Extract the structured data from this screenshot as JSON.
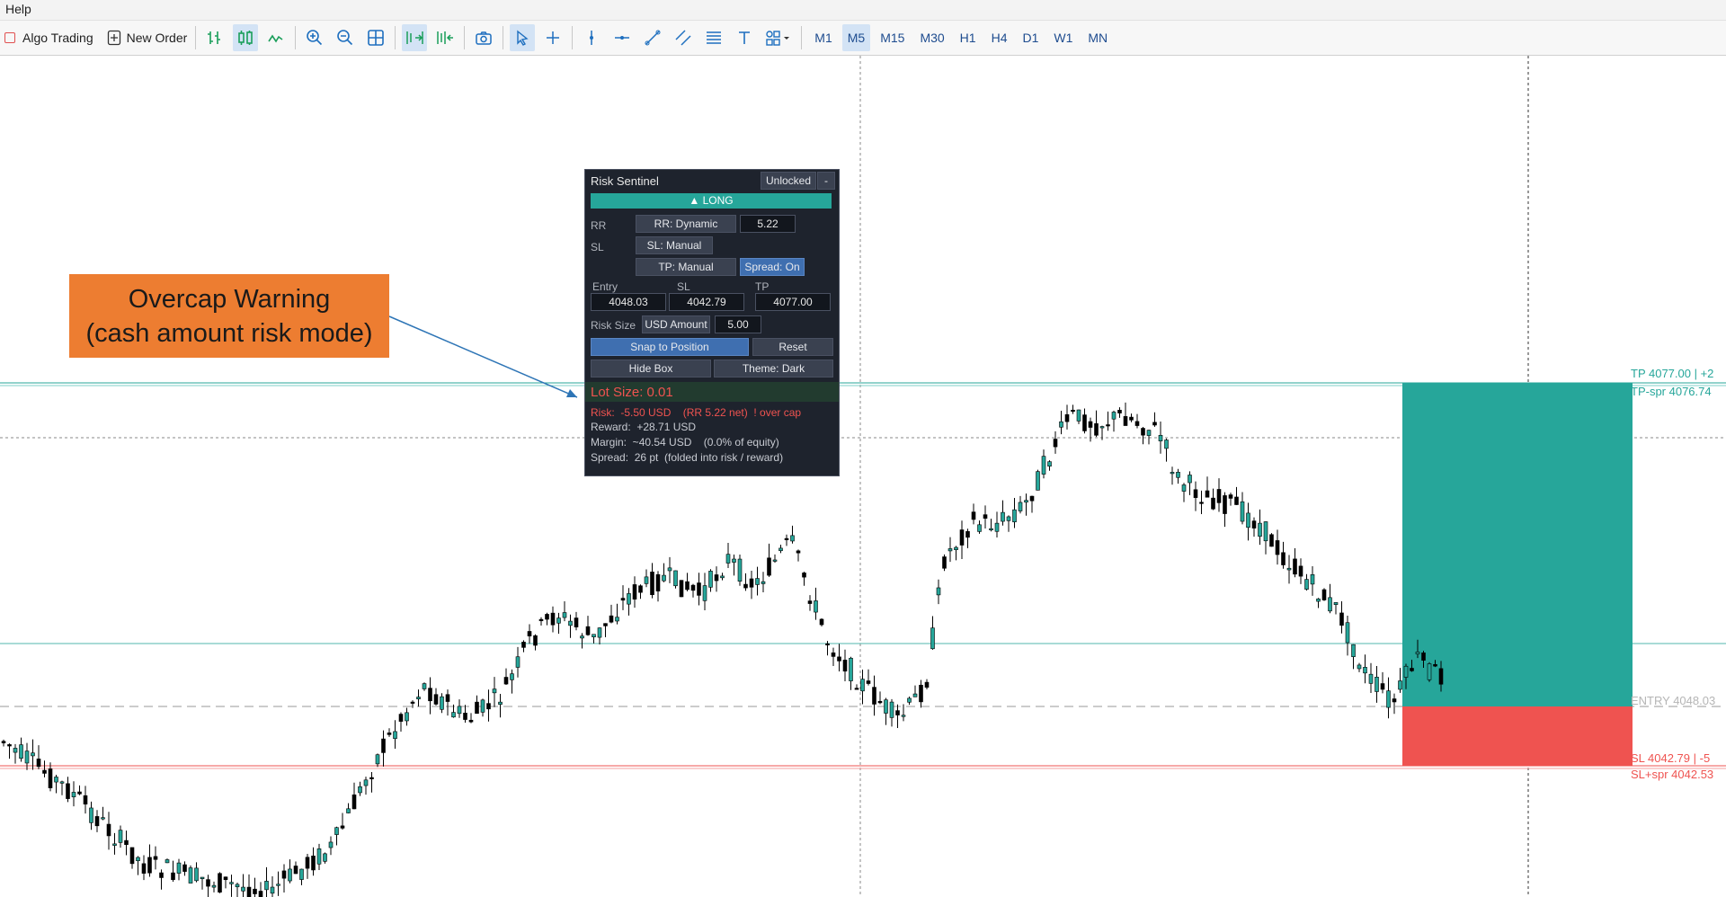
{
  "menubar": {
    "help": "Help"
  },
  "toolbar": {
    "algo_trading": "Algo Trading",
    "new_order": "New Order",
    "timeframes": [
      "M1",
      "M5",
      "M15",
      "M30",
      "H1",
      "H4",
      "D1",
      "W1",
      "MN"
    ],
    "active_timeframe": "M5"
  },
  "chart": {
    "labels": {
      "tp": "TP 4077.00  |  +2",
      "tp_spr": "TP-spr 4076.74",
      "entry": "ENTRY 4048.03",
      "sl": "SL 4042.79  |  -5",
      "sl_spr": "SL+spr 4042.53"
    },
    "colors": {
      "tp": "#26a69a",
      "sl": "#ef5350",
      "entry": "#aaaaaa",
      "candle": "#26a69a"
    }
  },
  "callout": {
    "line1": "Overcap Warning",
    "line2": "(cash amount risk mode)",
    "color": "#ed7d31"
  },
  "panel": {
    "title": "Risk Sentinel",
    "lock_button": "Unlocked",
    "minimize_button": "-",
    "direction_button": "▲ LONG",
    "rr_label": "RR",
    "rr_mode": "RR: Dynamic",
    "rr_value": "5.22",
    "sl_label": "SL",
    "sl_mode": "SL: Manual",
    "tp_mode": "TP: Manual",
    "spread_toggle": "Spread: On",
    "entry_label": "Entry",
    "sl_price_label": "SL",
    "tp_price_label": "TP",
    "entry_value": "4048.03",
    "sl_value": "4042.79",
    "tp_value": "4077.00",
    "risk_size_label": "Risk Size",
    "risk_mode": "USD Amount",
    "risk_value": "5.00",
    "snap_button": "Snap to Position",
    "reset_button": "Reset",
    "hide_button": "Hide Box",
    "theme_button": "Theme: Dark",
    "lot_size": "Lot Size:  0.01",
    "risk_line": "Risk:  -5.50 USD    (RR 5.22 net)  ! over cap",
    "reward_line": "Reward:  +28.71 USD",
    "margin_line": "Margin:  ~40.54 USD    (0.0% of equity)",
    "spread_line": "Spread:  26 pt  (folded into risk / reward)"
  }
}
